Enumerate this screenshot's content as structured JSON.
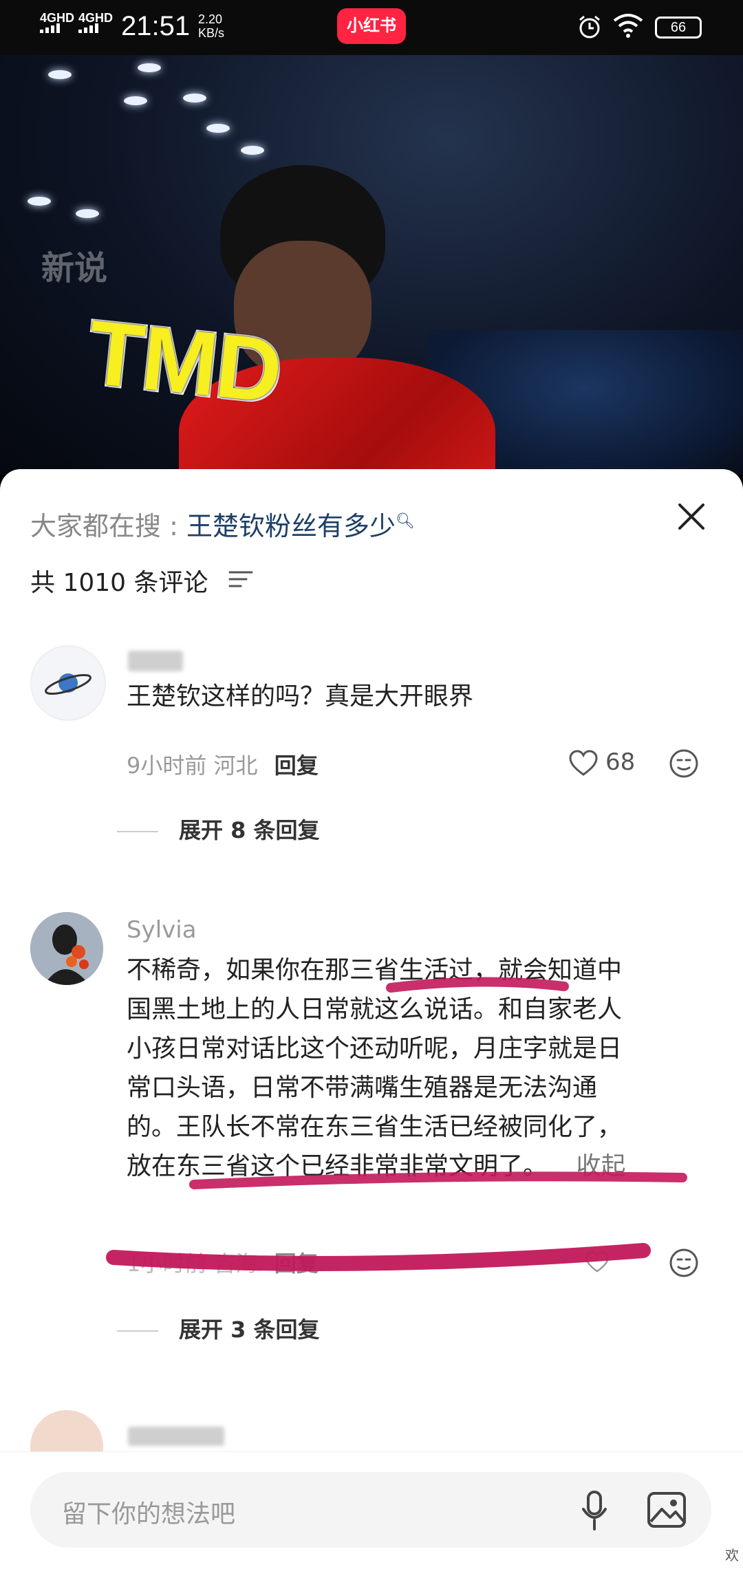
{
  "status_bar": {
    "network1": "4GHD",
    "network2": "4GHD",
    "time": "21:51",
    "speed_value": "2.20",
    "speed_unit": "KB/s",
    "app_logo": "小红书",
    "battery": "66"
  },
  "video": {
    "watermark": "新说",
    "caption": "TMD"
  },
  "comments_panel": {
    "search_prefix": "大家都在搜 : ",
    "search_query": "王楚钦粉丝有多少",
    "total_count": "共 1010 条评论",
    "close_icon": "close-icon",
    "sort_icon": "filter-lines-icon"
  },
  "comments": [
    {
      "username": "",
      "text": "王楚钦这样的吗？真是大开眼界",
      "time": "9小时前",
      "location": "河北",
      "reply_label": "回复",
      "likes": "68",
      "expand_label": "展开 8 条回复"
    },
    {
      "username": "Sylvia",
      "lines": [
        "不稀奇，如果你在那三省生活过，就会知道中",
        "国黑土地上的人日常就这么说话。和自家老人",
        "小孩日常对话比这个还动听呢，月庄字就是日",
        "常口头语，日常不带满嘴生殖器是无法沟通",
        "的。王队长不常在东三省生活已经被同化了，",
        "放在东三省这个已经非常非常文明了。"
      ],
      "collapse_label": "收起",
      "time": "1小时前",
      "location": "吉海",
      "reply_label": "回复",
      "likes": "",
      "expand_label": "展开 3 条回复"
    }
  ],
  "bottom_bar": {
    "input_placeholder": "留下你的想法吧",
    "mic_icon": "microphone-icon",
    "image_icon": "image-icon",
    "corner_text": "欢"
  },
  "colors": {
    "brand": "#ff2442",
    "search_query": "#1d3f66",
    "marker": "#c2185b"
  }
}
